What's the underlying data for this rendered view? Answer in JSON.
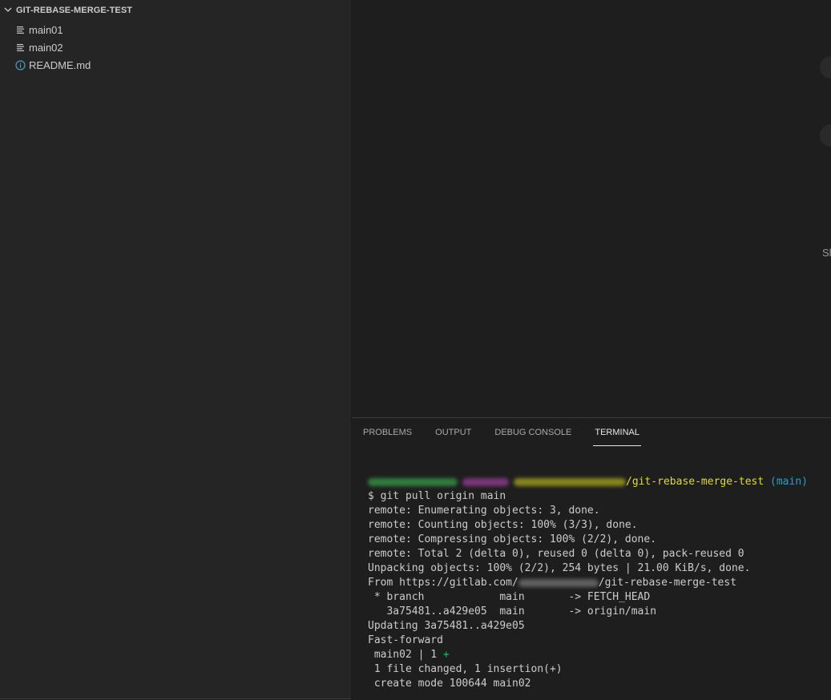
{
  "explorer": {
    "section_title": "GIT-REBASE-MERGE-TEST",
    "files": [
      {
        "name": "main01",
        "icon": "lines-file-icon"
      },
      {
        "name": "main02",
        "icon": "lines-file-icon"
      },
      {
        "name": "README.md",
        "icon": "info-icon"
      }
    ]
  },
  "editor": {
    "partial_text": "Sh"
  },
  "panel": {
    "tabs": [
      {
        "label": "PROBLEMS",
        "active": false
      },
      {
        "label": "OUTPUT",
        "active": false
      },
      {
        "label": "DEBUG CONSOLE",
        "active": false
      },
      {
        "label": "TERMINAL",
        "active": true
      }
    ]
  },
  "terminal": {
    "prompt_path": "/git-rebase-merge-test",
    "prompt_branch": "(main)",
    "lines": [
      "$ git pull origin main",
      "remote: Enumerating objects: 3, done.",
      "remote: Counting objects: 100% (3/3), done.",
      "remote: Compressing objects: 100% (2/2), done.",
      "remote: Total 2 (delta 0), reused 0 (delta 0), pack-reused 0",
      "Unpacking objects: 100% (2/2), 254 bytes | 21.00 KiB/s, done."
    ],
    "from_prefix": "From https://gitlab.com/",
    "from_suffix": "/git-rebase-merge-test",
    "lines2": [
      " * branch            main       -> FETCH_HEAD",
      "   3a75481..a429e05  main       -> origin/main",
      "Updating 3a75481..a429e05",
      "Fast-forward"
    ],
    "stat_prefix": " main02 | 1 ",
    "stat_plus": "+",
    "lines3": [
      " 1 file changed, 1 insertion(+)",
      " create mode 100644 main02"
    ]
  },
  "colors": {
    "prompt_path": "#dcdc35",
    "prompt_branch": "#1fa3c9",
    "diff_plus": "#2bb673"
  }
}
